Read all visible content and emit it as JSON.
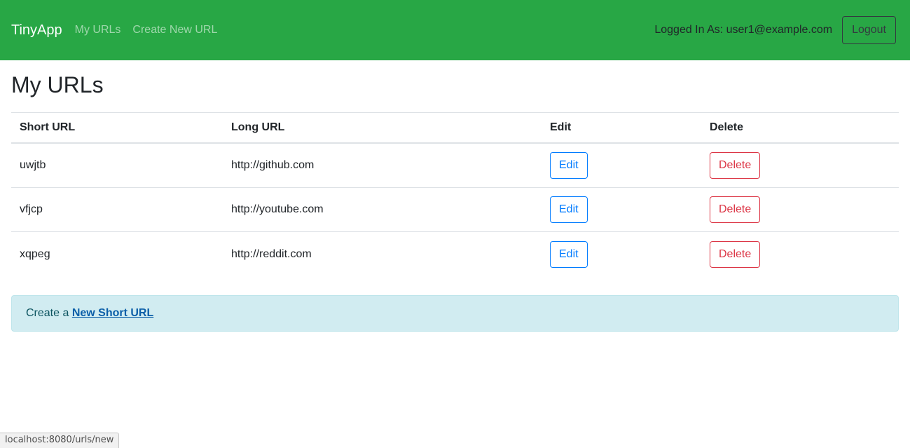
{
  "navbar": {
    "brand": "TinyApp",
    "links": [
      {
        "label": "My URLs"
      },
      {
        "label": "Create New URL"
      }
    ],
    "user_text": "Logged In As: user1@example.com",
    "logout_label": "Logout",
    "background_color": "#28a745"
  },
  "main": {
    "page_title": "My URLs",
    "table": {
      "columns": [
        "Short URL",
        "Long URL",
        "Edit",
        "Delete"
      ],
      "rows": [
        {
          "short_url": "uwjtb",
          "long_url": "http://github.com",
          "edit_label": "Edit",
          "delete_label": "Delete"
        },
        {
          "short_url": "vfjcp",
          "long_url": "http://youtube.com",
          "edit_label": "Edit",
          "delete_label": "Delete"
        },
        {
          "short_url": "xqpeg",
          "long_url": "http://reddit.com",
          "edit_label": "Edit",
          "delete_label": "Delete"
        }
      ]
    },
    "alert": {
      "prefix": "Create a ",
      "link_label": "New Short URL",
      "background_color": "#d1ecf1",
      "text_color": "#0c5460"
    }
  },
  "browser": {
    "status_text": "localhost:8080/urls/new"
  },
  "colors": {
    "primary": "#007bff",
    "danger": "#dc3545",
    "success": "#28a745",
    "dark": "#343a40"
  }
}
